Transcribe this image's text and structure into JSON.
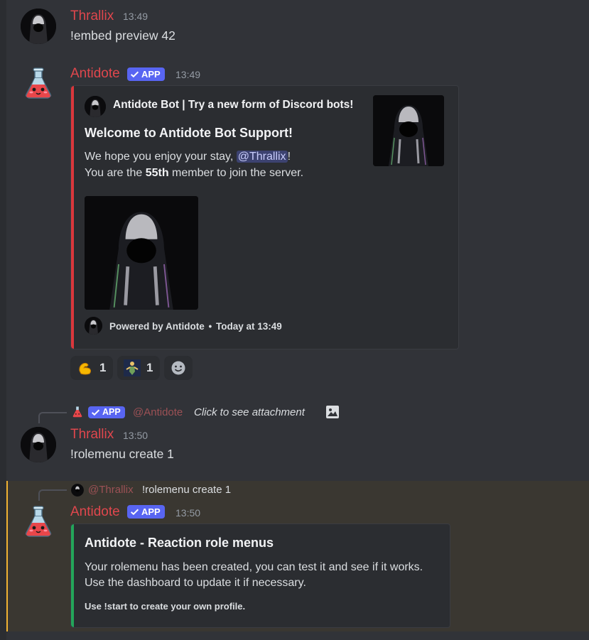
{
  "messages": [
    {
      "author": "Thrallix",
      "time": "13:49",
      "text": "!embed preview 42"
    },
    {
      "author": "Antidote",
      "badge": "APP",
      "time": "13:49",
      "embed": {
        "author_name": "Antidote Bot | Try a new form of Discord bots!",
        "title": "Welcome to Antidote Bot Support!",
        "line1_prefix": "We hope you enjoy your stay, ",
        "line1_mention": "@Thrallix",
        "line1_suffix": "!",
        "line2_prefix": "You are the ",
        "line2_bold": "55th",
        "line2_suffix": " member to join the server.",
        "footer_text": "Powered by Antidote",
        "footer_sep": "•",
        "footer_time": "Today at 13:49",
        "bar_color": "#da373c"
      },
      "reactions": [
        {
          "emoji": "flexed-bicep-emoji",
          "count": "1"
        },
        {
          "emoji": "custom-sticker-emoji",
          "count": "1"
        }
      ]
    },
    {
      "reply": {
        "badge": "APP",
        "mention": "@Antidote",
        "text": "Click to see attachment"
      },
      "author": "Thrallix",
      "time": "13:50",
      "text": "!rolemenu create 1"
    },
    {
      "reply": {
        "mention": "@Thrallix",
        "text": "!rolemenu create 1"
      },
      "author": "Antidote",
      "badge": "APP",
      "time": "13:50",
      "embed": {
        "title": "Antidote - Reaction role menus",
        "line1": "Your rolemenu has been created, you can test it and see if it works.",
        "line2": "Use the dashboard to update it if necessary.",
        "footer_text": "Use !start to create your own profile.",
        "bar_color": "#23a55a"
      }
    }
  ],
  "colors": {
    "background": "#313338",
    "username": "#e0474d",
    "app_badge": "#5865f2",
    "mention_highlight": "#f0b232"
  }
}
